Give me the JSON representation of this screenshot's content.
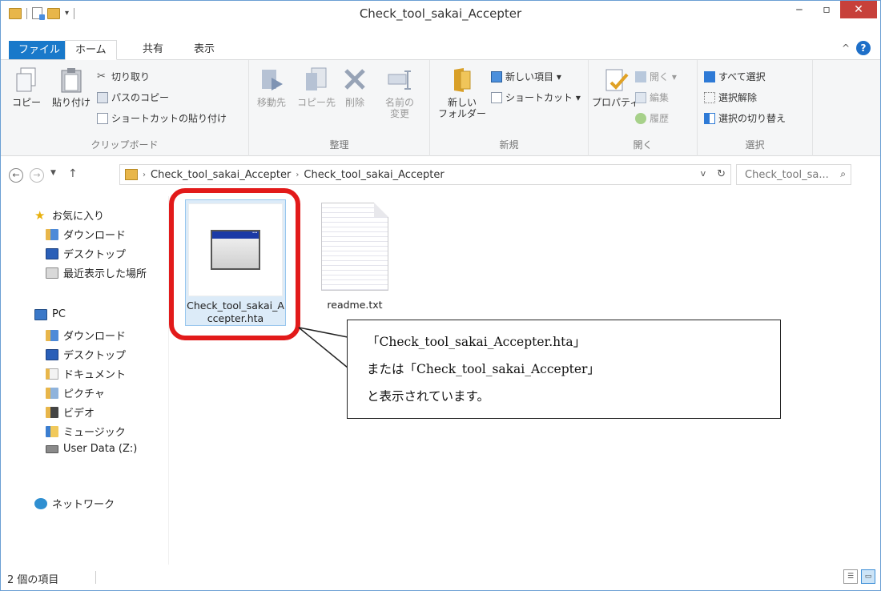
{
  "window": {
    "title": "Check_tool_sakai_Accepter"
  },
  "tabs": {
    "file": "ファイル",
    "home": "ホーム",
    "share": "共有",
    "view": "表示"
  },
  "ribbon": {
    "clipboard": {
      "label": "クリップボード",
      "copy": "コピー",
      "paste": "貼り付け",
      "cut": "切り取り",
      "copy_path": "パスのコピー",
      "paste_shortcut": "ショートカットの貼り付け"
    },
    "organize": {
      "label": "整理",
      "move_to": "移動先",
      "copy_to": "コピー先",
      "delete": "削除",
      "rename_1": "名前の",
      "rename_2": "変更"
    },
    "new": {
      "label": "新規",
      "new_folder_1": "新しい",
      "new_folder_2": "フォルダー",
      "new_item": "新しい項目 ▾",
      "shortcut": "ショートカット ▾"
    },
    "open": {
      "label": "開く",
      "properties": "プロパティ",
      "open": "開く ▾",
      "edit": "編集",
      "history": "履歴"
    },
    "select": {
      "label": "選択",
      "select_all": "すべて選択",
      "select_none": "選択解除",
      "invert": "選択の切り替え"
    }
  },
  "address": {
    "crumb1": "Check_tool_sakai_Accepter",
    "crumb2": "Check_tool_sakai_Accepter",
    "search_placeholder": "Check_tool_sa..."
  },
  "nav": {
    "favorites": "お気に入り",
    "fav_items": [
      "ダウンロード",
      "デスクトップ",
      "最近表示した場所"
    ],
    "pc": "PC",
    "pc_items": [
      "ダウンロード",
      "デスクトップ",
      "ドキュメント",
      "ピクチャ",
      "ビデオ",
      "ミュージック",
      "User Data (Z:)"
    ],
    "network": "ネットワーク"
  },
  "files": [
    {
      "name": "Check_tool_sakai_Accepter.hta"
    },
    {
      "name": "readme.txt"
    }
  ],
  "callout": {
    "line1": "「Check_tool_sakai_Accepter.hta」",
    "line2": "または「Check_tool_sakai_Accepter」",
    "line3": "と表示されています。"
  },
  "status": {
    "count": "2 個の項目"
  },
  "colors": {
    "accent": "#1979ca",
    "highlight": "#e21a1a",
    "selection": "#dcebf8"
  }
}
